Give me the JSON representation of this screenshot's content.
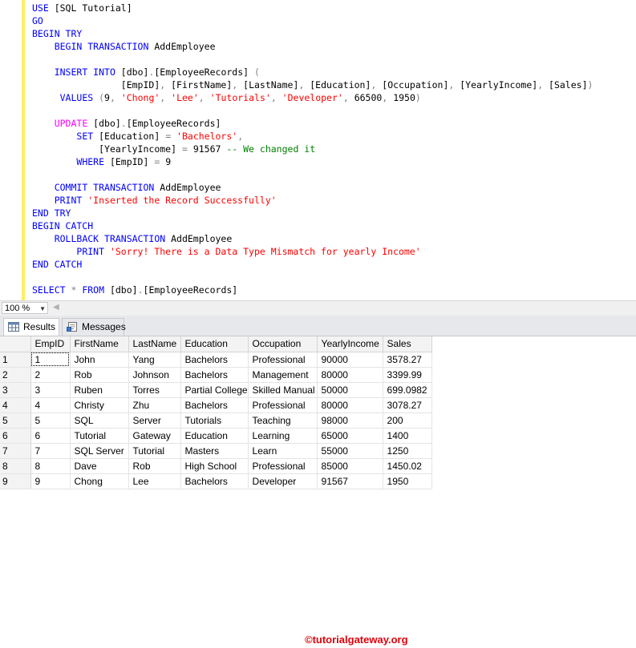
{
  "editor": {
    "lines": [
      [
        {
          "t": "USE ",
          "c": "kw"
        },
        {
          "t": "[SQL Tutorial]",
          "c": "tx"
        }
      ],
      [
        {
          "t": "GO",
          "c": "kw"
        }
      ],
      [
        {
          "t": "BEGIN TRY",
          "c": "kw"
        }
      ],
      [
        {
          "t": "    ",
          "c": "tx"
        },
        {
          "t": "BEGIN TRANSACTION ",
          "c": "kw"
        },
        {
          "t": "AddEmployee",
          "c": "tx"
        }
      ],
      [],
      [
        {
          "t": "    ",
          "c": "tx"
        },
        {
          "t": "INSERT INTO ",
          "c": "kw"
        },
        {
          "t": "[dbo]",
          "c": "tx"
        },
        {
          "t": ".",
          "c": "op"
        },
        {
          "t": "[EmployeeRecords] ",
          "c": "tx"
        },
        {
          "t": "(",
          "c": "op"
        }
      ],
      [
        {
          "t": "                ",
          "c": "tx"
        },
        {
          "t": "[EmpID]",
          "c": "tx"
        },
        {
          "t": ", ",
          "c": "op"
        },
        {
          "t": "[FirstName]",
          "c": "tx"
        },
        {
          "t": ", ",
          "c": "op"
        },
        {
          "t": "[LastName]",
          "c": "tx"
        },
        {
          "t": ", ",
          "c": "op"
        },
        {
          "t": "[Education]",
          "c": "tx"
        },
        {
          "t": ", ",
          "c": "op"
        },
        {
          "t": "[Occupation]",
          "c": "tx"
        },
        {
          "t": ", ",
          "c": "op"
        },
        {
          "t": "[YearlyIncome]",
          "c": "tx"
        },
        {
          "t": ", ",
          "c": "op"
        },
        {
          "t": "[Sales]",
          "c": "tx"
        },
        {
          "t": ")",
          "c": "op"
        }
      ],
      [
        {
          "t": "     ",
          "c": "tx"
        },
        {
          "t": "VALUES ",
          "c": "kw"
        },
        {
          "t": "(",
          "c": "op"
        },
        {
          "t": "9",
          "c": "tx"
        },
        {
          "t": ", ",
          "c": "op"
        },
        {
          "t": "'Chong'",
          "c": "str"
        },
        {
          "t": ", ",
          "c": "op"
        },
        {
          "t": "'Lee'",
          "c": "str"
        },
        {
          "t": ", ",
          "c": "op"
        },
        {
          "t": "'Tutorials'",
          "c": "str"
        },
        {
          "t": ", ",
          "c": "op"
        },
        {
          "t": "'Developer'",
          "c": "str"
        },
        {
          "t": ", ",
          "c": "op"
        },
        {
          "t": "66500",
          "c": "tx"
        },
        {
          "t": ", ",
          "c": "op"
        },
        {
          "t": "1950",
          "c": "tx"
        },
        {
          "t": ")",
          "c": "op"
        }
      ],
      [],
      [
        {
          "t": "    ",
          "c": "tx"
        },
        {
          "t": "UPDATE ",
          "c": "fn"
        },
        {
          "t": "[dbo]",
          "c": "tx"
        },
        {
          "t": ".",
          "c": "op"
        },
        {
          "t": "[EmployeeRecords]",
          "c": "tx"
        }
      ],
      [
        {
          "t": "        ",
          "c": "tx"
        },
        {
          "t": "SET ",
          "c": "kw"
        },
        {
          "t": "[Education] ",
          "c": "tx"
        },
        {
          "t": "= ",
          "c": "op"
        },
        {
          "t": "'Bachelors'",
          "c": "str"
        },
        {
          "t": ",",
          "c": "op"
        }
      ],
      [
        {
          "t": "            ",
          "c": "tx"
        },
        {
          "t": "[YearlyIncome] ",
          "c": "tx"
        },
        {
          "t": "= ",
          "c": "op"
        },
        {
          "t": "91567 ",
          "c": "tx"
        },
        {
          "t": "-- We changed it",
          "c": "cm"
        }
      ],
      [
        {
          "t": "        ",
          "c": "tx"
        },
        {
          "t": "WHERE ",
          "c": "kw"
        },
        {
          "t": "[EmpID] ",
          "c": "tx"
        },
        {
          "t": "= ",
          "c": "op"
        },
        {
          "t": "9",
          "c": "tx"
        }
      ],
      [],
      [
        {
          "t": "    ",
          "c": "tx"
        },
        {
          "t": "COMMIT TRANSACTION ",
          "c": "kw"
        },
        {
          "t": "AddEmployee",
          "c": "tx"
        }
      ],
      [
        {
          "t": "    ",
          "c": "tx"
        },
        {
          "t": "PRINT ",
          "c": "kw"
        },
        {
          "t": "'Inserted the Record Successfully'",
          "c": "str"
        }
      ],
      [
        {
          "t": "END TRY",
          "c": "kw"
        }
      ],
      [
        {
          "t": "BEGIN CATCH",
          "c": "kw"
        }
      ],
      [
        {
          "t": "    ",
          "c": "tx"
        },
        {
          "t": "ROLLBACK TRANSACTION ",
          "c": "kw"
        },
        {
          "t": "AddEmployee",
          "c": "tx"
        }
      ],
      [
        {
          "t": "        ",
          "c": "tx"
        },
        {
          "t": "PRINT ",
          "c": "kw"
        },
        {
          "t": "'Sorry! There is a Data Type Mismatch for yearly Income'",
          "c": "str"
        }
      ],
      [
        {
          "t": "END CATCH",
          "c": "kw"
        }
      ],
      [],
      [
        {
          "t": "SELECT ",
          "c": "kw"
        },
        {
          "t": "* ",
          "c": "op"
        },
        {
          "t": "FROM ",
          "c": "kw"
        },
        {
          "t": "[dbo]",
          "c": "tx"
        },
        {
          "t": ".",
          "c": "op"
        },
        {
          "t": "[EmployeeRecords]",
          "c": "tx"
        }
      ]
    ]
  },
  "statusbar": {
    "zoom": "100 %"
  },
  "tabs": {
    "results": "Results",
    "messages": "Messages"
  },
  "watermark": "©tutorialgateway.org",
  "results": {
    "columns": [
      "EmpID",
      "FirstName",
      "LastName",
      "Education",
      "Occupation",
      "YearlyIncome",
      "Sales"
    ],
    "rows": [
      {
        "num": "1",
        "cells": [
          "1",
          "John",
          "Yang",
          "Bachelors",
          "Professional",
          "90000",
          "3578.27"
        ]
      },
      {
        "num": "2",
        "cells": [
          "2",
          "Rob",
          "Johnson",
          "Bachelors",
          "Management",
          "80000",
          "3399.99"
        ]
      },
      {
        "num": "3",
        "cells": [
          "3",
          "Ruben",
          "Torres",
          "Partial College",
          "Skilled Manual",
          "50000",
          "699.0982"
        ]
      },
      {
        "num": "4",
        "cells": [
          "4",
          "Christy",
          "Zhu",
          "Bachelors",
          "Professional",
          "80000",
          "3078.27"
        ]
      },
      {
        "num": "5",
        "cells": [
          "5",
          "SQL",
          "Server",
          "Tutorials",
          "Teaching",
          "98000",
          "200"
        ]
      },
      {
        "num": "6",
        "cells": [
          "6",
          "Tutorial",
          "Gateway",
          "Education",
          "Learning",
          "65000",
          "1400"
        ]
      },
      {
        "num": "7",
        "cells": [
          "7",
          "SQL Server",
          "Tutorial",
          "Masters",
          "Learn",
          "55000",
          "1250"
        ]
      },
      {
        "num": "8",
        "cells": [
          "8",
          "Dave",
          "Rob",
          "High School",
          "Professional",
          "85000",
          "1450.02"
        ]
      },
      {
        "num": "9",
        "cells": [
          "9",
          "Chong",
          "Lee",
          "Bachelors",
          "Developer",
          "91567",
          "1950"
        ]
      }
    ]
  }
}
